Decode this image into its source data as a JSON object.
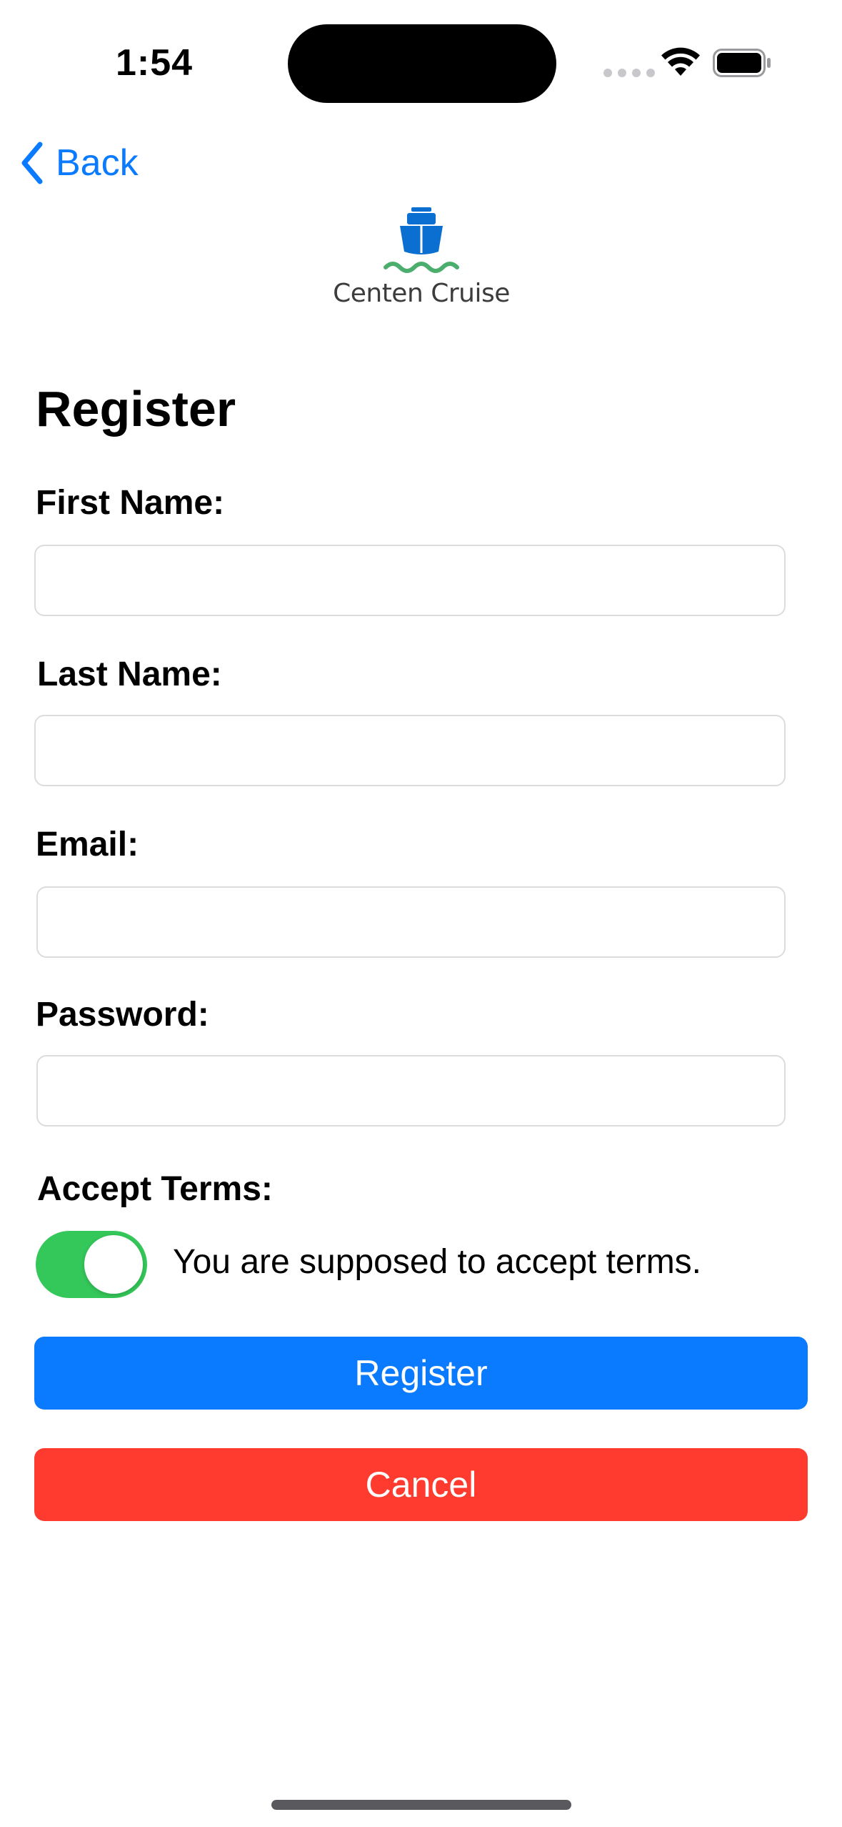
{
  "status_bar": {
    "time": "1:54"
  },
  "nav": {
    "back_label": "Back"
  },
  "logo": {
    "text": "Centen Cruise"
  },
  "form": {
    "title": "Register",
    "fields": [
      {
        "label": "First Name:",
        "value": "",
        "placeholder": ""
      },
      {
        "label": "Last Name:",
        "value": "",
        "placeholder": ""
      },
      {
        "label": "Email:",
        "value": "",
        "placeholder": ""
      },
      {
        "label": "Password:",
        "value": "",
        "placeholder": ""
      }
    ],
    "terms": {
      "label": "Accept Terms:",
      "toggle_on": true,
      "description": "You are supposed to accept terms."
    },
    "register_label": "Register",
    "cancel_label": "Cancel"
  },
  "colors": {
    "accent": "#0a7aff",
    "toggle_on": "#34c759",
    "destructive": "#ff3b30",
    "logo_ship": "#0b6fd1",
    "logo_waves": "#4cae6c"
  }
}
